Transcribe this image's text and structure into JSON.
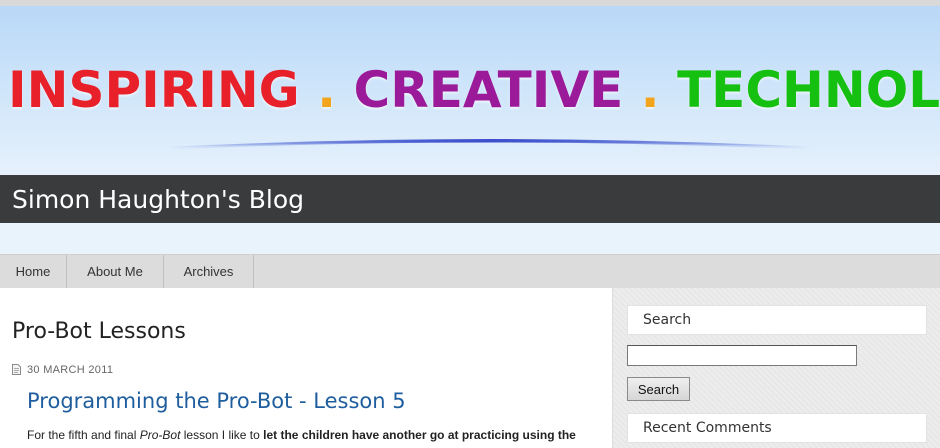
{
  "banner": {
    "word1": "INSPIRING",
    "sep1": " . ",
    "word2": "CREATIVE",
    "sep2": " . ",
    "word3": "TECHNOLOGY"
  },
  "blog": {
    "title": "Simon Haughton's Blog"
  },
  "nav": {
    "items": [
      {
        "label": "Home"
      },
      {
        "label": "About Me"
      },
      {
        "label": "Archives"
      }
    ]
  },
  "main": {
    "page_heading": "Pro-Bot Lessons",
    "post": {
      "date": "30 MARCH 2011",
      "title": "Programming the Pro-Bot - Lesson 5",
      "excerpt_start": "For the fifth and final ",
      "excerpt_italic": "Pro-Bot",
      "excerpt_mid": " lesson I like to ",
      "excerpt_bold": "let the children have another go at practicing using the"
    }
  },
  "sidebar": {
    "search_title": "Search",
    "search_value": "",
    "search_button": "Search",
    "recent_comments_title": "Recent Comments"
  },
  "colors": {
    "word1": "#e8202a",
    "word2": "#9b1a9a",
    "word3": "#16c010",
    "dots": "#f2a51c",
    "blog_bar": "#3a3b3d",
    "post_title": "#1f5e9e"
  }
}
